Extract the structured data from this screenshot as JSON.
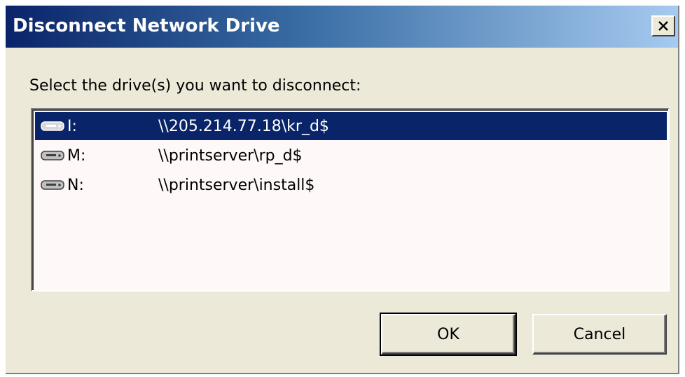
{
  "window": {
    "title": "Disconnect Network Drive",
    "close_label": "X"
  },
  "prompt": "Select the drive(s) you want to disconnect:",
  "drives": [
    {
      "letter": "I:",
      "path": "\\\\205.214.77.18\\kr_d$",
      "selected": true,
      "icon": "network-drive-icon"
    },
    {
      "letter": "M:",
      "path": "\\\\printserver\\rp_d$",
      "selected": false,
      "icon": "network-drive-icon"
    },
    {
      "letter": "N:",
      "path": "\\\\printserver\\install$",
      "selected": false,
      "icon": "network-drive-icon"
    }
  ],
  "buttons": {
    "ok": "OK",
    "cancel": "Cancel"
  },
  "colors": {
    "title_bar": "#0a246a",
    "selection": "#0a246a",
    "dialog_face": "#ece9d8"
  }
}
